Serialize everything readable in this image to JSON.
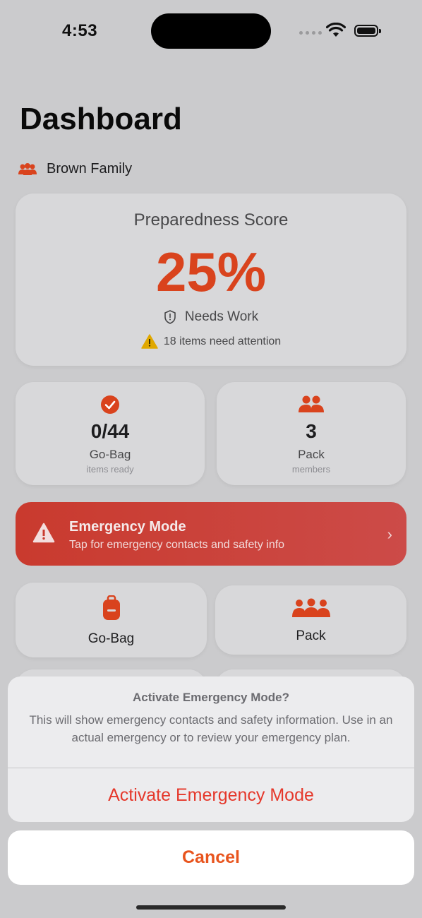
{
  "status_bar": {
    "time": "4:53"
  },
  "header": {
    "title": "Dashboard",
    "family_name": "Brown Family"
  },
  "score_card": {
    "title": "Preparedness Score",
    "value": "25%",
    "status": "Needs Work",
    "attention": "18 items need attention"
  },
  "stats": [
    {
      "value": "0/44",
      "label": "Go-Bag",
      "sub": "items ready",
      "icon": "checkmark-circle-icon"
    },
    {
      "value": "3",
      "label": "Pack",
      "sub": "members",
      "icon": "people-icon"
    }
  ],
  "emergency_banner": {
    "title": "Emergency Mode",
    "subtitle": "Tap for emergency contacts and safety info",
    "icon": "warning-triangle-icon"
  },
  "tiles": [
    {
      "label": "Go-Bag",
      "icon": "backpack-icon"
    },
    {
      "label": "Pack",
      "icon": "group-icon"
    }
  ],
  "action_sheet": {
    "title": "Activate Emergency Mode?",
    "message": "This will show emergency contacts and safety information. Use in an actual emergency or to review your emergency plan.",
    "action_label": "Activate Emergency Mode",
    "cancel_label": "Cancel"
  },
  "colors": {
    "accent": "#d9431d",
    "emergency": "#c93a2e",
    "destructive": "#e5382b",
    "warning": "#e0a800"
  }
}
